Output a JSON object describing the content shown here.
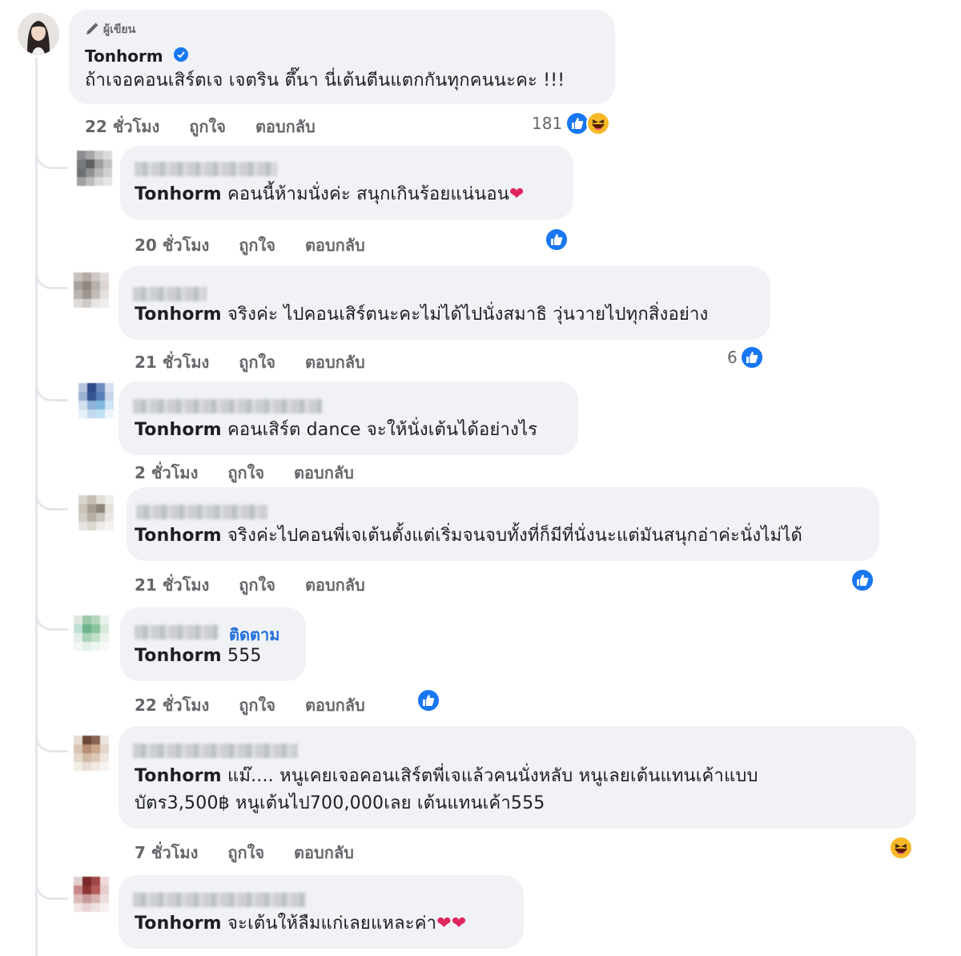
{
  "author_comment": {
    "author_badge": "ผู้เขียน",
    "name": "Tonhorm",
    "text": "ถ้าเจอคอนเสิร์ตเจ เจตริน ตึ๊นา นี่เต้นตีนแตกกันทุกคนนะคะ !!!",
    "time": "22 ชั่วโมง",
    "reaction_count": "181"
  },
  "labels": {
    "like": "ถูกใจ",
    "reply": "ตอบกลับ",
    "follow": "ติดตาม"
  },
  "replies": [
    {
      "mention": "Tonhorm",
      "text": "คอนนี้ห้ามนั่งค่ะ สนุกเกินร้อยแน่นอน",
      "emoji": "❤",
      "time": "20 ชั่วโมง",
      "count": ""
    },
    {
      "mention": "Tonhorm",
      "text": "จริงค่ะ ไปคอนเสิร์ตนะคะไม่ได้ไปนั่งสมาธิ วุ่นวายไปทุกสิ่งอย่าง",
      "emoji": "",
      "time": "21 ชั่วโมง",
      "count": "6"
    },
    {
      "mention": "Tonhorm",
      "text": "คอนเสิร์ต dance จะให้นั่งเต้นได้อย่างไร",
      "emoji": "",
      "time": "2 ชั่วโมง",
      "count": ""
    },
    {
      "mention": "Tonhorm",
      "text": "จริงค่ะไปคอนพี่เจเต้นตั้งแต่เริ่มจนจบทั้งที่ก็มีที่นั่งนะแต่มันสนุกอ่าค่ะนั่งไม่ได้",
      "emoji": "",
      "time": "21 ชั่วโมง",
      "count": ""
    },
    {
      "mention": "Tonhorm",
      "text": "555",
      "emoji": "",
      "time": "22 ชั่วโมง",
      "count": ""
    },
    {
      "mention": "Tonhorm",
      "text": "แม๊.... หนูเคยเจอคอนเสิร์ตพี่เจแล้วคนนั่งหลับ หนูเลยเต้นแทนเค้าแบบ",
      "text2": "บัตร3,500฿ หนูเต้นไป700,000เลย เต้นแทนเค้า555",
      "emoji": "",
      "time": "7 ชั่วโมง",
      "count": ""
    },
    {
      "mention": "Tonhorm",
      "text": "จะเต้นให้ลืมแก่เลยแหละค่า",
      "emoji": "❤❤",
      "time": "",
      "count": ""
    }
  ],
  "icons": {
    "like": "like-thumb-icon",
    "haha": "haha-emoji-icon",
    "verified": "verified-badge-icon",
    "pencil": "pencil-icon"
  },
  "colors": {
    "bubble": "#f0f2f5",
    "meta": "#65676b",
    "like_blue": "#1877f2",
    "follow_link": "#216fdb",
    "heart": "#e0245e"
  }
}
